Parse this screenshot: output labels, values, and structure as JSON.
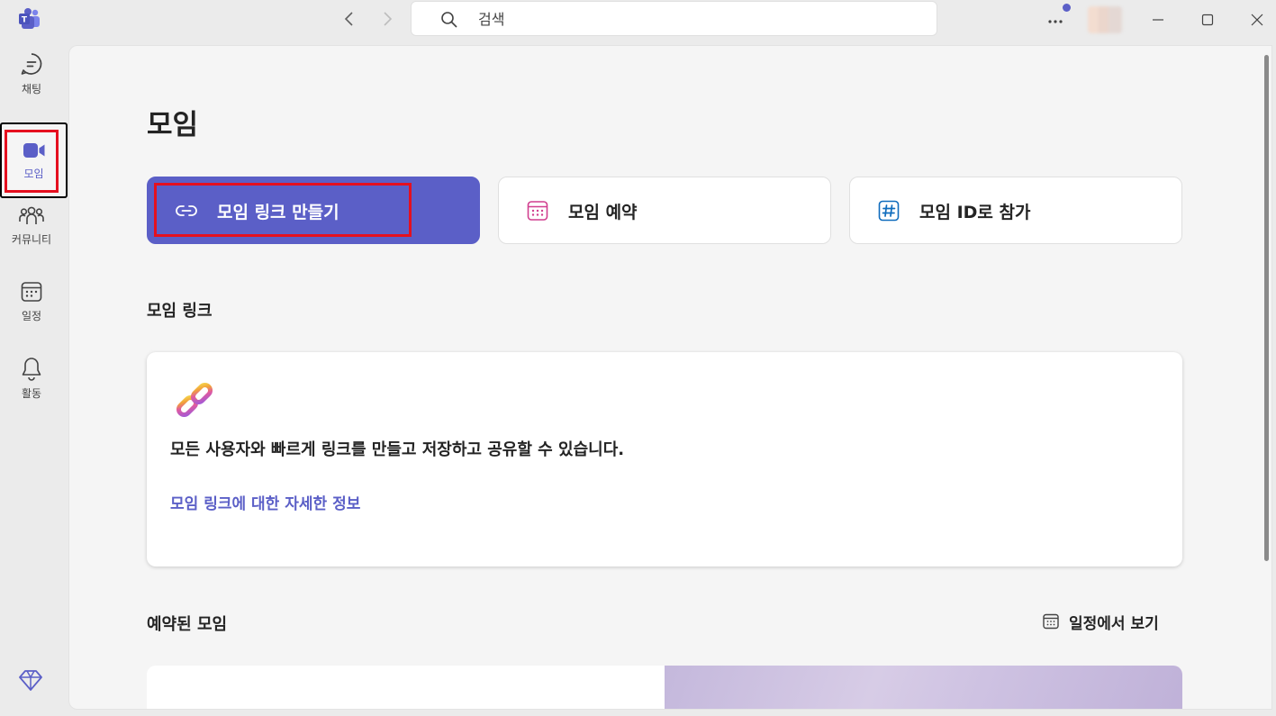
{
  "titlebar": {
    "search_placeholder": "검색"
  },
  "rail": {
    "items": [
      {
        "label": "채팅",
        "icon": "chat-icon"
      },
      {
        "label": "모임",
        "icon": "video-icon"
      },
      {
        "label": "커뮤니티",
        "icon": "community-icon"
      },
      {
        "label": "일정",
        "icon": "calendar-icon"
      },
      {
        "label": "활동",
        "icon": "bell-icon"
      }
    ],
    "active": "모임"
  },
  "main": {
    "title": "모임",
    "actions": {
      "create_link": "모임 링크 만들기",
      "schedule": "모임 예약",
      "join_id": "모임 ID로 참가"
    },
    "links_section": {
      "heading": "모임 링크",
      "description": "모든 사용자와 빠르게 링크를 만들고 저장하고 공유할 수 있습니다.",
      "learn_more": "모임 링크에 대한 자세한 정보"
    },
    "scheduled_section": {
      "heading": "예약된 모임",
      "view_calendar": "일정에서 보기"
    }
  },
  "colors": {
    "accent": "#5b5fc7",
    "highlight_box": "#e5101f",
    "schedule_icon": "#d13f8f",
    "join_icon": "#0f6cbd"
  }
}
